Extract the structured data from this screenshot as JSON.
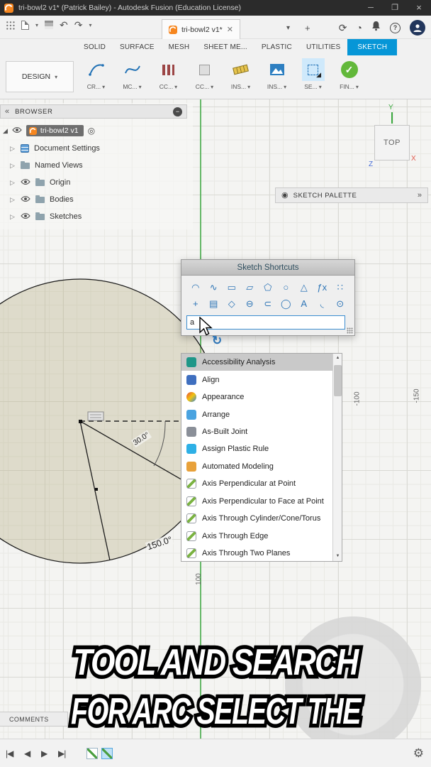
{
  "titlebar": {
    "title": "tri-bowl2 v1* (Patrick Bailey) - Autodesk Fusion (Education License)"
  },
  "qtoolbar": {
    "document_tab_label": "tri-bowl2 v1*"
  },
  "ribbon": {
    "tabs": [
      "SOLID",
      "SURFACE",
      "MESH",
      "SHEET ME...",
      "PLASTIC",
      "UTILITIES",
      "SKETCH"
    ],
    "active_tab": "SKETCH",
    "design_button": "DESIGN",
    "tools": [
      {
        "label": "CR..."
      },
      {
        "label": "MC..."
      },
      {
        "label": "CC..."
      },
      {
        "label": "CC..."
      },
      {
        "label": "INS..."
      },
      {
        "label": "INS..."
      },
      {
        "label": "SE..."
      },
      {
        "label": "FIN..."
      }
    ]
  },
  "browser": {
    "header": "BROWSER",
    "root_label": "tri-bowl2 v1",
    "items": [
      {
        "label": "Document Settings",
        "icon": "document-settings-icon",
        "has_eye": false
      },
      {
        "label": "Named Views",
        "icon": "folder-icon",
        "has_eye": false
      },
      {
        "label": "Origin",
        "icon": "folder-icon",
        "has_eye": true
      },
      {
        "label": "Bodies",
        "icon": "folder-icon",
        "has_eye": true
      },
      {
        "label": "Sketches",
        "icon": "folder-icon",
        "has_eye": true
      }
    ]
  },
  "viewcube": {
    "face": "TOP",
    "axis_x": "X",
    "axis_y": "Y",
    "axis_z": "Z"
  },
  "sketch_palette": {
    "title": "SKETCH PALETTE"
  },
  "canvas": {
    "angle_dim_1": "30.0°",
    "angle_dim_2": "150.0°",
    "axis_label_1": "-150",
    "axis_label_2": "-100",
    "axis_label_3": "100",
    "axis_color": "#3aa83e",
    "profile_fill": "#bab28c"
  },
  "shortcuts": {
    "title": "Sketch Shortcuts",
    "search_value": "a",
    "grid_row1": [
      "arc-icon",
      "spline-icon",
      "rectangle-2pt-icon",
      "rectangle-icon",
      "polygon-icon",
      "circle-icon",
      "mirror-icon",
      "function-icon",
      "pattern-icon"
    ],
    "grid_row2": [
      "move-icon",
      "copy-icon",
      "polygon2-icon",
      "slot-icon",
      "offset-icon",
      "ellipse-icon",
      "text-icon",
      "fillet-icon",
      "project-icon"
    ],
    "results": [
      {
        "label": "Accessibility Analysis",
        "icon": "accessibility-analysis-icon",
        "color": "#1e9688",
        "selected": true
      },
      {
        "label": "Align",
        "icon": "align-icon",
        "color": "#3f6fbf",
        "selected": false
      },
      {
        "label": "Appearance",
        "icon": "appearance-icon",
        "color": "#d94f3d",
        "gradient": "linear-gradient(135deg,#e74c3c 0%,#f1c40f 50%,#2e86de 100%)",
        "selected": false
      },
      {
        "label": "Arrange",
        "icon": "arrange-icon",
        "color": "#4aa3e0",
        "selected": false
      },
      {
        "label": "As-Built Joint",
        "icon": "as-built-joint-icon",
        "color": "#8a8f98",
        "selected": false
      },
      {
        "label": "Assign Plastic Rule",
        "icon": "assign-plastic-rule-icon",
        "color": "#2eb0e6",
        "selected": false
      },
      {
        "label": "Automated Modeling",
        "icon": "automated-modeling-icon",
        "color": "#e8a13a",
        "selected": false
      },
      {
        "label": "Axis Perpendicular at Point",
        "icon": "axis-perpendicular-at-point-icon",
        "color": "#7bb342",
        "selected": false
      },
      {
        "label": "Axis Perpendicular to Face at Point",
        "icon": "axis-perpendicular-to-face-at-point-icon",
        "color": "#7bb342",
        "selected": false
      },
      {
        "label": "Axis Through Cylinder/Cone/Torus",
        "icon": "axis-through-cylinder-cone-torus-icon",
        "color": "#7bb342",
        "selected": false
      },
      {
        "label": "Axis Through Edge",
        "icon": "axis-through-edge-icon",
        "color": "#7bb342",
        "selected": false
      },
      {
        "label": "Axis Through Two Planes",
        "icon": "axis-through-two-planes-icon",
        "color": "#7bb342",
        "selected": false
      }
    ]
  },
  "caption": {
    "line1": "TOOL AND SEARCH",
    "line2": "FOR ARC SELECT THE"
  },
  "comments": {
    "label": "COMMENTS"
  }
}
